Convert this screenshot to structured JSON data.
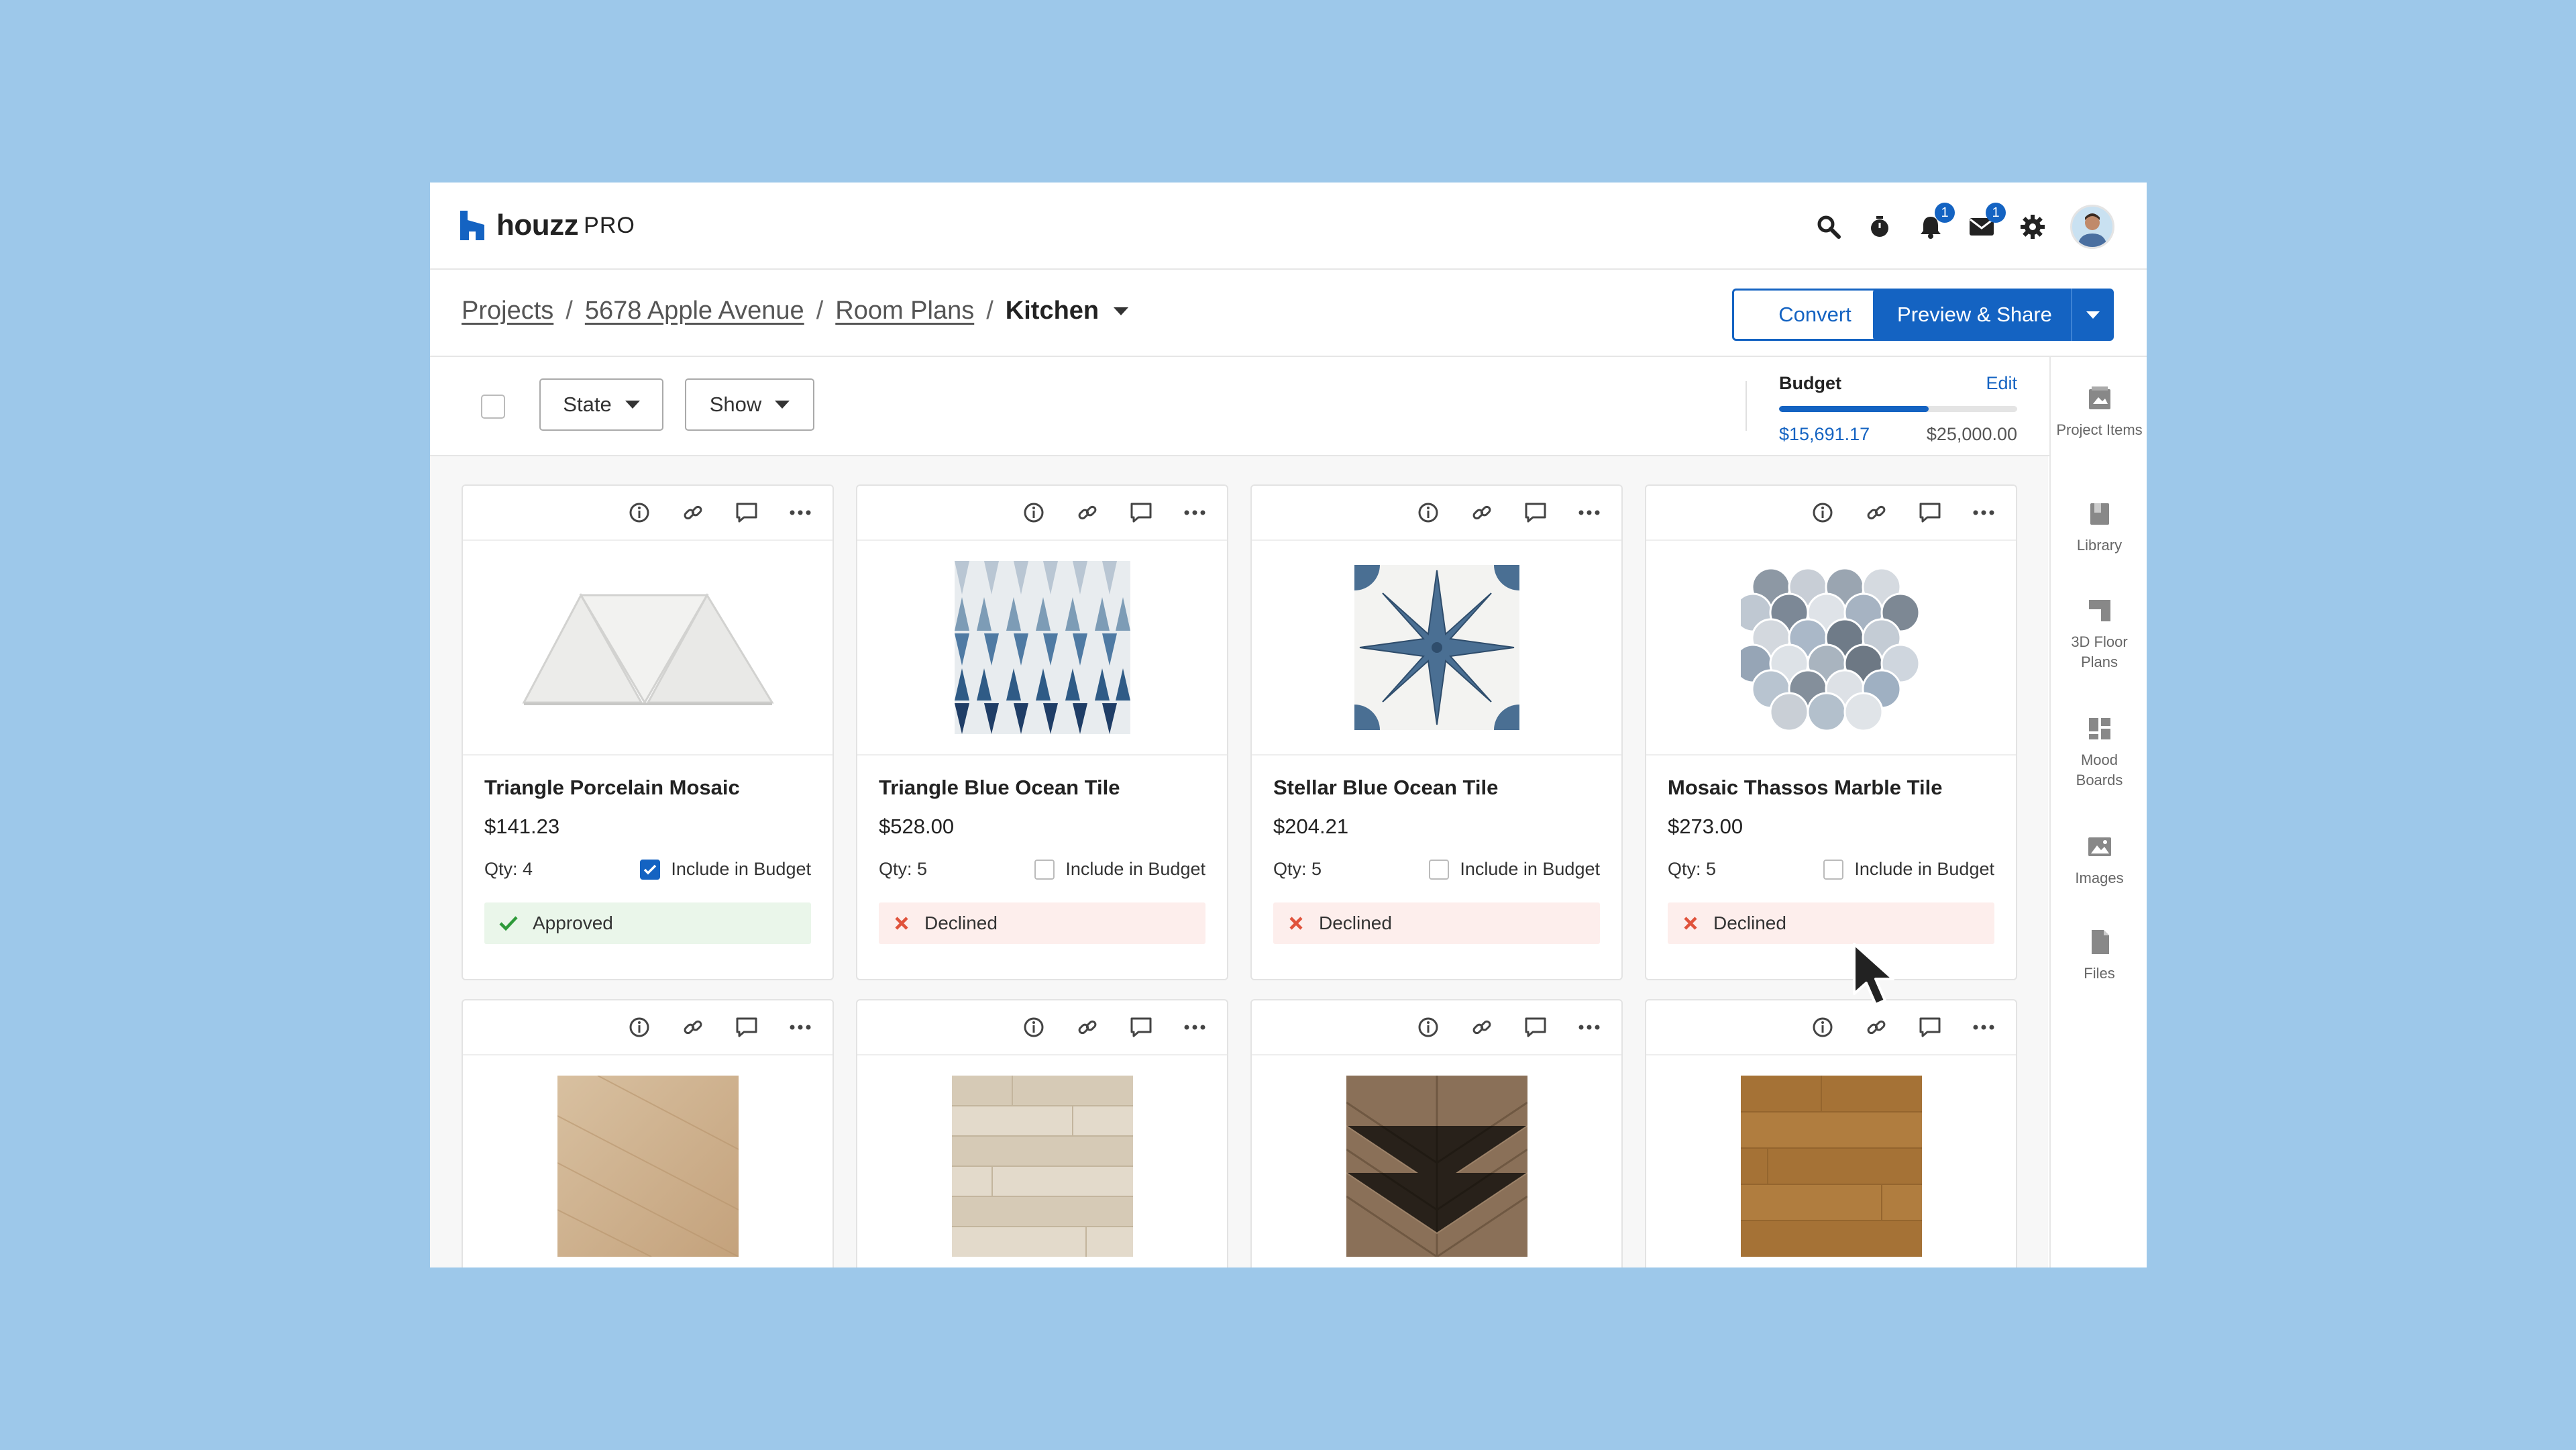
{
  "app": {
    "logo_word": "houzz",
    "logo_suffix": "PRO"
  },
  "top_icons": [
    {
      "name": "search-icon"
    },
    {
      "name": "timer-icon"
    },
    {
      "name": "bell-icon",
      "badge": "1"
    },
    {
      "name": "mail-icon",
      "badge": "1"
    },
    {
      "name": "gear-icon"
    },
    {
      "name": "avatar"
    }
  ],
  "breadcrumb": {
    "items": [
      "Projects",
      "5678 Apple Avenue",
      "Room Plans"
    ],
    "current": "Kitchen",
    "separator": "/"
  },
  "actions": {
    "convert": "Convert",
    "preview_share": "Preview & Share"
  },
  "filters": {
    "state": "State",
    "show": "Show"
  },
  "budget": {
    "title": "Budget",
    "edit": "Edit",
    "spent": "$15,691.17",
    "total": "$25,000.00",
    "progress_fraction": 0.628
  },
  "rail": [
    {
      "label": "Project Items",
      "icon": "project-items-icon"
    },
    {
      "label": "Library",
      "icon": "library-icon"
    },
    {
      "label": "3D Floor Plans",
      "icon": "floor-plan-icon"
    },
    {
      "label": "Mood Boards",
      "icon": "mood-board-icon"
    },
    {
      "label": "Images",
      "icon": "image-icon"
    },
    {
      "label": "Files",
      "icon": "file-icon"
    }
  ],
  "card_tools": [
    "info-icon",
    "link-icon",
    "comment-icon",
    "more-icon"
  ],
  "include_label": "Include in Budget",
  "cards": [
    {
      "title": "Triangle Porcelain Mosaic",
      "price": "$141.23",
      "qty": "Qty: 4",
      "included": true,
      "status": "Approved"
    },
    {
      "title": "Triangle Blue Ocean Tile",
      "price": "$528.00",
      "qty": "Qty: 5",
      "included": false,
      "status": "Declined"
    },
    {
      "title": "Stellar Blue Ocean Tile",
      "price": "$204.21",
      "qty": "Qty: 5",
      "included": false,
      "status": "Declined"
    },
    {
      "title": "Mosaic Thassos Marble Tile",
      "price": "$273.00",
      "qty": "Qty: 5",
      "included": false,
      "status": "Declined"
    }
  ],
  "colors": {
    "accent": "#1463c2",
    "background": "#9dc8ea",
    "approved_bg": "#eaf6ea",
    "declined_bg": "#fdeeec",
    "approved_icon": "#2e9a3a",
    "declined_icon": "#e0533c"
  }
}
